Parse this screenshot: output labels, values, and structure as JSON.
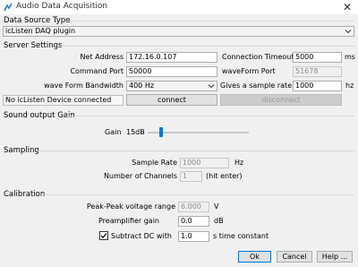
{
  "window": {
    "title": "Audio Data Acquisition",
    "close_glyph": "✕"
  },
  "data_source": {
    "section_label": "Data Source Type",
    "type_value": "icListen DAQ  plugin"
  },
  "server": {
    "section_label": "Server Settings",
    "net_address_label": "Net Address",
    "net_address_value": "172.16.0.107",
    "connection_timeout_label": "Connection Timeout:",
    "connection_timeout_value": "5000",
    "connection_timeout_unit": "ms",
    "command_port_label": "Command Port",
    "command_port_value": "50000",
    "waveform_port_label": "waveForm Port",
    "waveform_port_value": "51678",
    "bandwidth_label": "wave Form Bandwidth",
    "bandwidth_value": "400 Hz",
    "sample_rate_label": "Gives a sample rate of:",
    "sample_rate_value": "1000",
    "sample_rate_unit": "hz",
    "status_text": "No icListen Device connected",
    "connect_label": "connect",
    "disconnect_label": "disconnect"
  },
  "sound_output": {
    "section_label": "Sound output Gain",
    "gain_label": "Gain",
    "gain_value": "15dB",
    "gain_level_fraction": 0.12
  },
  "sampling": {
    "section_label": "Sampling",
    "sample_rate_label": "Sample Rate",
    "sample_rate_value": "1000",
    "sample_rate_unit": "Hz",
    "channels_label": "Number of Channels",
    "channels_value": "1",
    "channels_hint": "(hit enter)"
  },
  "calibration": {
    "section_label": "Calibration",
    "pp_voltage_label": "Peak-Peak voltage range",
    "pp_voltage_value": "6.000",
    "pp_voltage_unit": "V",
    "preamp_label": "Preamplifier gain",
    "preamp_value": "0.0",
    "preamp_unit": "dB",
    "subtract_dc_label": "Subtract DC with",
    "subtract_dc_checked": true,
    "subtract_dc_value": "1.0",
    "subtract_dc_unit": "s time constant"
  },
  "footer": {
    "ok_label": "Ok",
    "cancel_label": "Cancel",
    "help_label": "Help ..."
  },
  "colors": {
    "accent": "#0078d7",
    "background": "#f0f0f0"
  }
}
